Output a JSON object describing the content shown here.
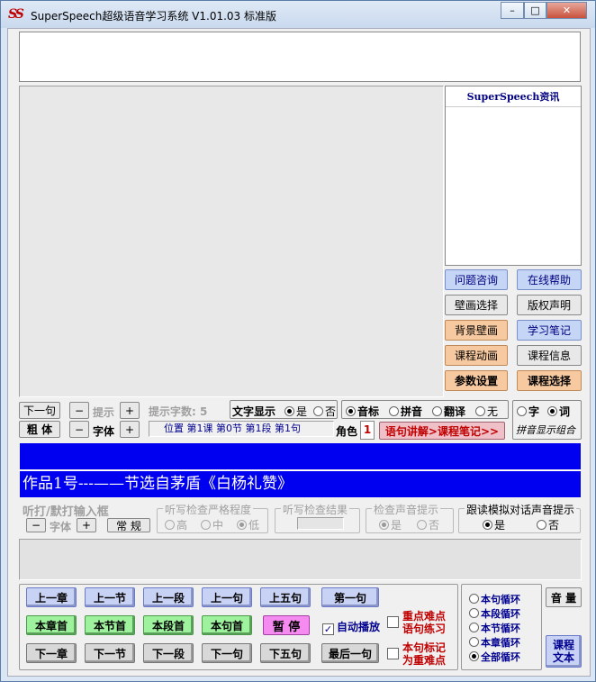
{
  "window": {
    "title": "SuperSpeech超级语音学习系统 V1.01.03   标准版",
    "icon_text": "SS",
    "minimize": "–",
    "maximize": "□",
    "close": "✕"
  },
  "info": {
    "header": "SuperSpeech资讯"
  },
  "right_buttons": [
    {
      "label": "问题咨询",
      "style": "blue"
    },
    {
      "label": "在线帮助",
      "style": "blue"
    },
    {
      "label": "壁画选择",
      "style": "grey"
    },
    {
      "label": "版权声明",
      "style": "grey"
    },
    {
      "label": "背景壁画",
      "style": "orange"
    },
    {
      "label": "学习笔记",
      "style": "blue"
    },
    {
      "label": "课程动画",
      "style": "orange"
    },
    {
      "label": "课程信息",
      "style": "grey"
    },
    {
      "label": "参数设置",
      "style": "orange"
    },
    {
      "label": "课程选择",
      "style": "orange"
    }
  ],
  "controls": {
    "prev_sentence": "下一句",
    "bold": "粗 体",
    "minus": "−",
    "plus": "+",
    "hint": "提示",
    "font": "字体",
    "hint_count_label": "提示字数:",
    "hint_count": "5",
    "text_display": "文字显示",
    "yes": "是",
    "no": "否",
    "phonetic": "音标",
    "pinyin": "拼音",
    "translate": "翻译",
    "none": "无",
    "char": "字",
    "word": "词",
    "pinyin_combo": "拼音显示组合",
    "position": "位置 第1课 第0节 第1段 第1句",
    "role": "角色",
    "role_value": "1",
    "lecture_link": "语句讲解>课程笔记>>"
  },
  "text_area": {
    "line1": "",
    "line2": "作品1号---——节选自茅盾《白杨礼赞》"
  },
  "dictation": {
    "title": "听打/默打输入框",
    "minus": "−",
    "font": "字体",
    "plus": "+",
    "normal": "常  规",
    "strict_group": "听写检查严格程度",
    "high": "高",
    "mid": "中",
    "low": "低",
    "result_group": "听写检查结果",
    "sound_group": "检查声音提示",
    "yes": "是",
    "no": "否",
    "dialog_group": "跟读模拟对话声音提示",
    "dialog_yes": "是",
    "dialog_no": "否"
  },
  "nav": {
    "row1": [
      "上一章",
      "上一节",
      "上一段",
      "上一句",
      "上五句",
      "第一句"
    ],
    "row2": [
      "本章首",
      "本节首",
      "本段首",
      "本句首",
      "暂 停"
    ],
    "row3": [
      "下一章",
      "下一节",
      "下一段",
      "下一句",
      "下五句",
      "最后一句"
    ],
    "auto_play": "自动播放",
    "key_sentence_1": "重点难点",
    "key_sentence_2": "语句练习",
    "mark_1": "本句标记",
    "mark_2": "为重难点",
    "loops": [
      "本句循环",
      "本段循环",
      "本节循环",
      "本章循环",
      "全部循环"
    ],
    "volume": "音 量",
    "course_text_1": "课程",
    "course_text_2": "文本"
  },
  "colors": {
    "text_blue_bg": "#0000f0",
    "link_red": "#c00000"
  }
}
